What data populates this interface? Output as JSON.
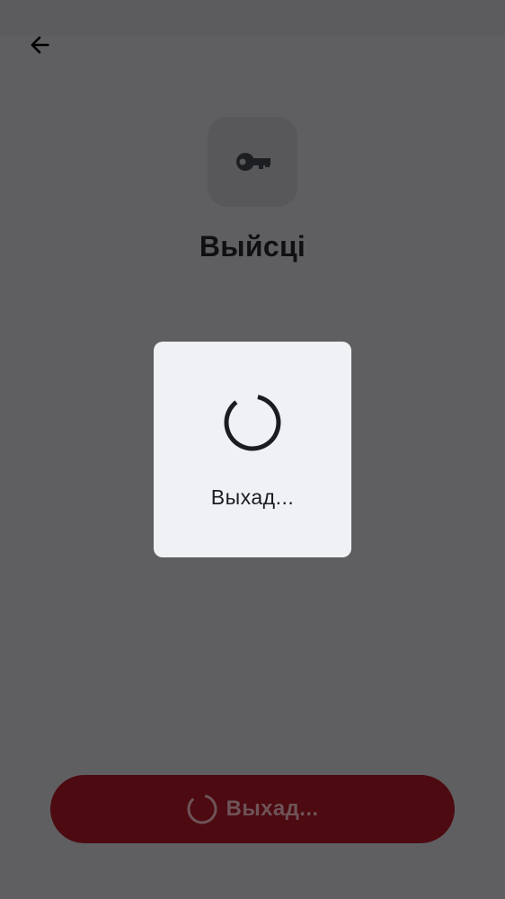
{
  "header": {
    "back_icon": "arrow-left-icon"
  },
  "hero": {
    "icon": "key-icon",
    "title": "Выйсці"
  },
  "dialog": {
    "icon": "loading-spinner-icon",
    "message": "Выхад..."
  },
  "logout_button": {
    "icon": "loading-spinner-icon",
    "label": "Выхад..."
  },
  "colors": {
    "scrim_background": "#5f5f61",
    "dialog_background": "#f0f1f5",
    "button_background": "#4d0a11",
    "title_text": "#101012"
  }
}
